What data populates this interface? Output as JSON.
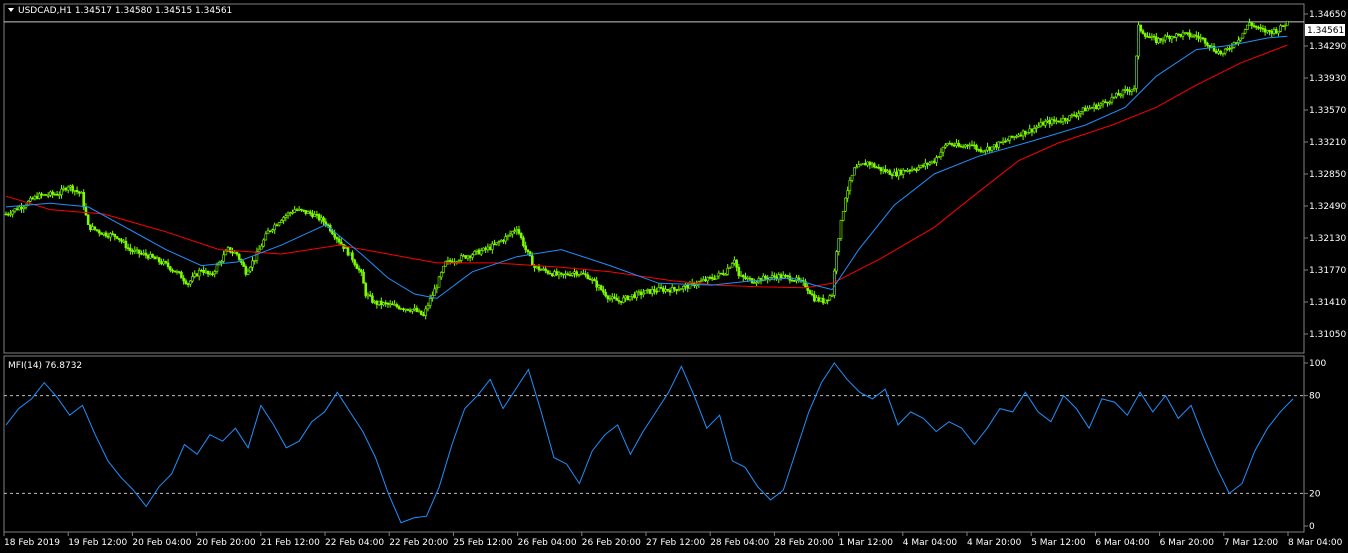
{
  "chart_data": [
    {
      "type": "candlestick",
      "title": "USDCAD,H1  1.34517 1.34580 1.34515 1.34561",
      "symbol": "USDCAD",
      "timeframe": "H1",
      "ohlc": {
        "open": 1.34517,
        "high": 1.3458,
        "low": 1.34515,
        "close": 1.34561
      },
      "last_price_label": "1.34561",
      "ylim": [
        1.3087,
        1.3474
      ],
      "ytick_labels": [
        "1.34650",
        "1.34290",
        "1.33930",
        "1.33570",
        "1.33210",
        "1.32850",
        "1.32490",
        "1.32130",
        "1.31770",
        "1.31410",
        "1.31050"
      ],
      "ytick_values": [
        1.3465,
        1.3429,
        1.3393,
        1.3357,
        1.3321,
        1.3285,
        1.3249,
        1.3213,
        1.3177,
        1.3141,
        1.3105
      ],
      "xtick_labels": [
        "18 Feb 2019",
        "19 Feb 12:00",
        "20 Feb 04:00",
        "20 Feb 20:00",
        "21 Feb 12:00",
        "22 Feb 04:00",
        "22 Feb 20:00",
        "25 Feb 12:00",
        "26 Feb 04:00",
        "26 Feb 20:00",
        "27 Feb 12:00",
        "28 Feb 04:00",
        "28 Feb 20:00",
        "1 Mar 12:00",
        "4 Mar 04:00",
        "4 Mar 20:00",
        "5 Mar 12:00",
        "6 Mar 04:00",
        "6 Mar 20:00",
        "7 Mar 12:00",
        "8 Mar 04:00"
      ],
      "close_path": [
        [
          0,
          1.324
        ],
        [
          8,
          1.325
        ],
        [
          14,
          1.326
        ],
        [
          20,
          1.3262
        ],
        [
          24,
          1.3263
        ],
        [
          28,
          1.3272
        ],
        [
          34,
          1.3262
        ],
        [
          37,
          1.3226
        ],
        [
          44,
          1.3218
        ],
        [
          50,
          1.3215
        ],
        [
          56,
          1.3199
        ],
        [
          64,
          1.3193
        ],
        [
          72,
          1.3183
        ],
        [
          78,
          1.3172
        ],
        [
          82,
          1.3162
        ],
        [
          88,
          1.3178
        ],
        [
          92,
          1.317
        ],
        [
          96,
          1.3185
        ],
        [
          100,
          1.32
        ],
        [
          104,
          1.3195
        ],
        [
          108,
          1.3175
        ],
        [
          112,
          1.319
        ],
        [
          118,
          1.322
        ],
        [
          124,
          1.3235
        ],
        [
          130,
          1.3245
        ],
        [
          138,
          1.324
        ],
        [
          144,
          1.323
        ],
        [
          150,
          1.321
        ],
        [
          156,
          1.319
        ],
        [
          160,
          1.3172
        ],
        [
          162,
          1.315
        ],
        [
          166,
          1.314
        ],
        [
          172,
          1.3138
        ],
        [
          178,
          1.3135
        ],
        [
          184,
          1.3132
        ],
        [
          188,
          1.3125
        ],
        [
          190,
          1.3138
        ],
        [
          194,
          1.316
        ],
        [
          198,
          1.3185
        ],
        [
          204,
          1.319
        ],
        [
          210,
          1.3195
        ],
        [
          216,
          1.32
        ],
        [
          220,
          1.3205
        ],
        [
          226,
          1.3215
        ],
        [
          230,
          1.3225
        ],
        [
          234,
          1.32
        ],
        [
          238,
          1.318
        ],
        [
          244,
          1.3175
        ],
        [
          250,
          1.317
        ],
        [
          256,
          1.3175
        ],
        [
          262,
          1.317
        ],
        [
          268,
          1.3155
        ],
        [
          272,
          1.3145
        ],
        [
          276,
          1.3142
        ],
        [
          282,
          1.3148
        ],
        [
          288,
          1.3152
        ],
        [
          294,
          1.3155
        ],
        [
          300,
          1.3155
        ],
        [
          306,
          1.3158
        ],
        [
          312,
          1.3163
        ],
        [
          318,
          1.3168
        ],
        [
          324,
          1.3175
        ],
        [
          328,
          1.319
        ],
        [
          330,
          1.317
        ],
        [
          336,
          1.3165
        ],
        [
          342,
          1.3168
        ],
        [
          348,
          1.317
        ],
        [
          354,
          1.3168
        ],
        [
          360,
          1.316
        ],
        [
          364,
          1.3145
        ],
        [
          368,
          1.3142
        ],
        [
          372,
          1.315
        ],
        [
          374,
          1.32
        ],
        [
          378,
          1.326
        ],
        [
          382,
          1.329
        ],
        [
          388,
          1.3298
        ],
        [
          394,
          1.329
        ],
        [
          400,
          1.3285
        ],
        [
          406,
          1.329
        ],
        [
          412,
          1.3293
        ],
        [
          418,
          1.33
        ],
        [
          424,
          1.332
        ],
        [
          430,
          1.3315
        ],
        [
          434,
          1.332
        ],
        [
          438,
          1.3312
        ],
        [
          444,
          1.3315
        ],
        [
          450,
          1.3322
        ],
        [
          456,
          1.333
        ],
        [
          462,
          1.3335
        ],
        [
          468,
          1.3343
        ],
        [
          474,
          1.3345
        ],
        [
          480,
          1.335
        ],
        [
          486,
          1.3358
        ],
        [
          492,
          1.3362
        ],
        [
          498,
          1.337
        ],
        [
          504,
          1.3378
        ],
        [
          508,
          1.3382
        ],
        [
          510,
          1.345
        ],
        [
          514,
          1.344
        ],
        [
          518,
          1.3435
        ],
        [
          524,
          1.344
        ],
        [
          530,
          1.3442
        ],
        [
          536,
          1.344
        ],
        [
          540,
          1.3435
        ],
        [
          544,
          1.3425
        ],
        [
          548,
          1.342
        ],
        [
          552,
          1.343
        ],
        [
          556,
          1.344
        ],
        [
          560,
          1.3455
        ],
        [
          564,
          1.3448
        ],
        [
          568,
          1.3445
        ],
        [
          573,
          1.3447
        ],
        [
          577,
          1.34561
        ]
      ],
      "ma_fast_path": [
        [
          0,
          1.3248
        ],
        [
          20,
          1.3252
        ],
        [
          37,
          1.3248
        ],
        [
          56,
          1.3222
        ],
        [
          72,
          1.32
        ],
        [
          88,
          1.3182
        ],
        [
          104,
          1.3186
        ],
        [
          124,
          1.3205
        ],
        [
          144,
          1.3228
        ],
        [
          160,
          1.3195
        ],
        [
          172,
          1.3168
        ],
        [
          184,
          1.315
        ],
        [
          194,
          1.3145
        ],
        [
          210,
          1.3175
        ],
        [
          230,
          1.3192
        ],
        [
          250,
          1.32
        ],
        [
          272,
          1.3182
        ],
        [
          294,
          1.3162
        ],
        [
          318,
          1.316
        ],
        [
          336,
          1.3165
        ],
        [
          354,
          1.3168
        ],
        [
          364,
          1.316
        ],
        [
          372,
          1.3155
        ],
        [
          384,
          1.32
        ],
        [
          400,
          1.325
        ],
        [
          418,
          1.3285
        ],
        [
          438,
          1.3305
        ],
        [
          462,
          1.3322
        ],
        [
          486,
          1.334
        ],
        [
          504,
          1.336
        ],
        [
          518,
          1.3395
        ],
        [
          536,
          1.3425
        ],
        [
          552,
          1.343
        ],
        [
          568,
          1.3438
        ],
        [
          577,
          1.344
        ]
      ],
      "ma_slow_path": [
        [
          0,
          1.326
        ],
        [
          20,
          1.3245
        ],
        [
          44,
          1.324
        ],
        [
          72,
          1.322
        ],
        [
          96,
          1.32
        ],
        [
          124,
          1.3195
        ],
        [
          150,
          1.3205
        ],
        [
          172,
          1.3195
        ],
        [
          194,
          1.3185
        ],
        [
          220,
          1.3185
        ],
        [
          250,
          1.318
        ],
        [
          272,
          1.3175
        ],
        [
          300,
          1.3165
        ],
        [
          320,
          1.316
        ],
        [
          340,
          1.3158
        ],
        [
          360,
          1.3157
        ],
        [
          372,
          1.3162
        ],
        [
          394,
          1.319
        ],
        [
          418,
          1.3225
        ],
        [
          438,
          1.3265
        ],
        [
          456,
          1.33
        ],
        [
          474,
          1.332
        ],
        [
          498,
          1.334
        ],
        [
          518,
          1.336
        ],
        [
          536,
          1.3385
        ],
        [
          556,
          1.341
        ],
        [
          577,
          1.343
        ]
      ],
      "colors": {
        "candle": "#7CFC00",
        "ma_fast": "#1E90FF",
        "ma_slow": "#FF0000",
        "grid": "#808080",
        "background": "#000000"
      }
    },
    {
      "type": "line",
      "title": "MFI(14) 76.8732",
      "indicator": "MFI(14)",
      "value": 76.8732,
      "ylim": [
        0,
        100
      ],
      "ytick_labels": [
        "100",
        "80",
        "20",
        "0"
      ],
      "ytick_values": [
        100,
        80,
        20,
        0
      ],
      "levels": [
        80,
        20
      ],
      "values": [
        62,
        72,
        78,
        88,
        79,
        68,
        74,
        56,
        40,
        30,
        22,
        12,
        24,
        32,
        50,
        44,
        56,
        52,
        60,
        48,
        74,
        62,
        48,
        52,
        64,
        70,
        82,
        70,
        58,
        42,
        20,
        2,
        5,
        6,
        24,
        50,
        72,
        80,
        90,
        72,
        84,
        96,
        70,
        42,
        38,
        26,
        46,
        56,
        62,
        44,
        58,
        70,
        82,
        98,
        80,
        60,
        68,
        40,
        36,
        24,
        16,
        22,
        46,
        70,
        88,
        100,
        90,
        82,
        78,
        84,
        62,
        70,
        66,
        58,
        64,
        60,
        50,
        60,
        72,
        70,
        82,
        70,
        64,
        80,
        72,
        60,
        78,
        76,
        68,
        82,
        70,
        80,
        66,
        74,
        54,
        36,
        20,
        26,
        46,
        60,
        70,
        78
      ],
      "colors": {
        "line": "#1E90FF",
        "level": "#BEBEBE"
      }
    }
  ]
}
